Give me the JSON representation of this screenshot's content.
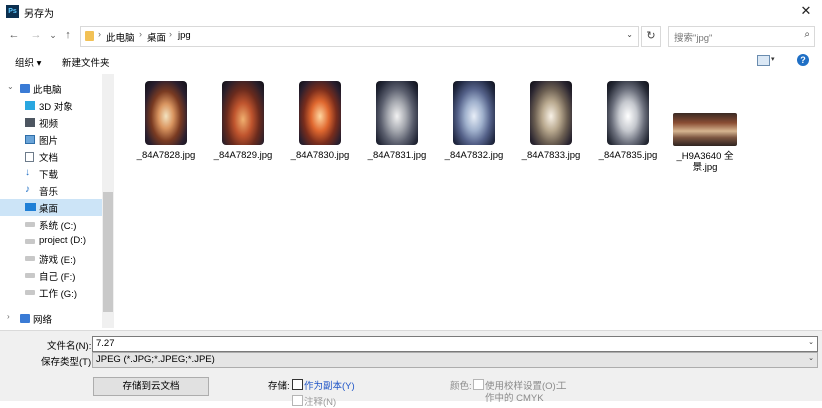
{
  "window": {
    "title": "另存为",
    "app_icon_text": "Ps"
  },
  "nav": {
    "back": "←",
    "forward": "→",
    "recent": "⌄",
    "up": "↑",
    "path": [
      "此电脑",
      "桌面",
      "jpg"
    ],
    "search_placeholder": "搜索\"jpg\""
  },
  "toolbar": {
    "organize": "组织 ▾",
    "new_folder": "新建文件夹"
  },
  "sidebar": {
    "items": [
      {
        "label": "此电脑",
        "icon": "pc-icon"
      },
      {
        "label": "3D 对象",
        "icon": "3d-objects-icon"
      },
      {
        "label": "视频",
        "icon": "video-icon"
      },
      {
        "label": "图片",
        "icon": "pictures-icon"
      },
      {
        "label": "文档",
        "icon": "documents-icon"
      },
      {
        "label": "下载",
        "icon": "download-icon"
      },
      {
        "label": "音乐",
        "icon": "music-icon"
      },
      {
        "label": "桌面",
        "icon": "desktop-icon"
      },
      {
        "label": "系统 (C:)",
        "icon": "drive-icon"
      },
      {
        "label": "project (D:)",
        "icon": "drive-icon"
      },
      {
        "label": "游戏 (E:)",
        "icon": "drive-icon"
      },
      {
        "label": "自己 (F:)",
        "icon": "drive-icon"
      },
      {
        "label": "工作 (G:)",
        "icon": "drive-icon"
      },
      {
        "label": "网络",
        "icon": "network-icon"
      }
    ]
  },
  "files": [
    {
      "name": "_84A7828.jpg"
    },
    {
      "name": "_84A7829.jpg"
    },
    {
      "name": "_84A7830.jpg"
    },
    {
      "name": "_84A7831.jpg"
    },
    {
      "name": "_84A7832.jpg"
    },
    {
      "name": "_84A7833.jpg"
    },
    {
      "name": "_84A7835.jpg"
    },
    {
      "name": "_H9A3640 全景.jpg"
    }
  ],
  "bottom": {
    "filename_label": "文件名(N):",
    "filename_value": "7.27",
    "filetype_label": "保存类型(T):",
    "filetype_value": "JPEG (*.JPG;*.JPEG;*.JPE)",
    "cloud_button": "存储到云文档",
    "storage_label": "存储:",
    "as_copy": "作为副本(Y)",
    "notes": "注释(N)",
    "color_label": "颜色:",
    "use_proof": "使用校样设置(O):",
    "proof_line1": "工",
    "proof_line2": "作中的 CMYK"
  }
}
